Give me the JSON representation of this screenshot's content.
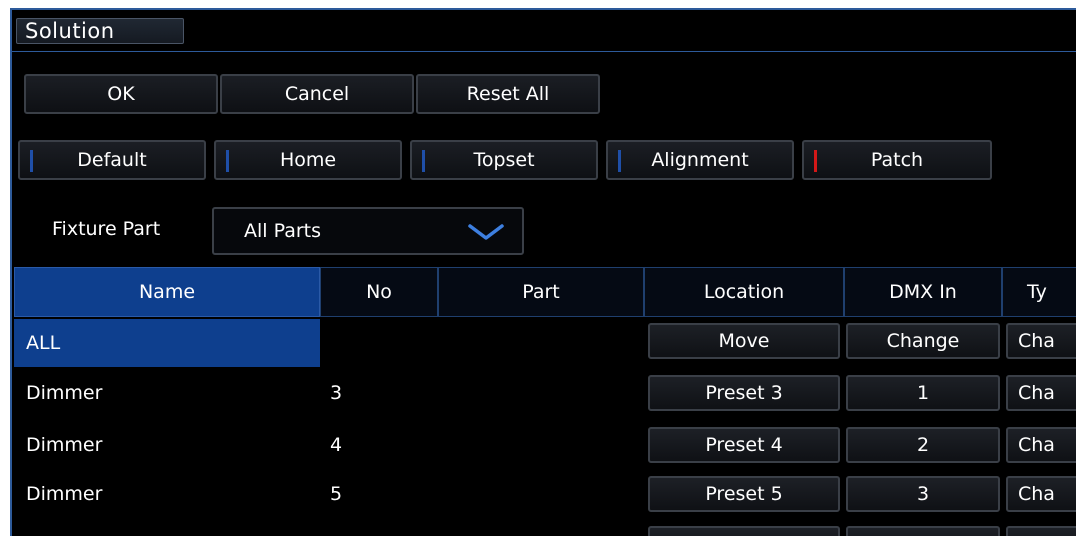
{
  "window": {
    "title": "Solution"
  },
  "buttons": {
    "ok": "OK",
    "cancel": "Cancel",
    "reset_all": "Reset All"
  },
  "modes": [
    {
      "label": "Default",
      "indicator": "#1f4fa8"
    },
    {
      "label": "Home",
      "indicator": "#1f4fa8"
    },
    {
      "label": "Topset",
      "indicator": "#1f4fa8"
    },
    {
      "label": "Alignment",
      "indicator": "#1f4fa8"
    },
    {
      "label": "Patch",
      "indicator": "#d31818"
    }
  ],
  "fixture_part": {
    "label": "Fixture Part",
    "value": "All Parts",
    "icon": "chevron-down-icon"
  },
  "table": {
    "columns": [
      "Name",
      "No",
      "Part",
      "Location",
      "DMX In",
      "Ty"
    ],
    "selected_column": "Name",
    "all_row": {
      "name": "ALL",
      "location": "Move",
      "dmx": "Change",
      "type": "Cha"
    },
    "rows": [
      {
        "name": "Dimmer",
        "no": "3",
        "location": "Preset 3",
        "dmx": "1",
        "type": "Cha"
      },
      {
        "name": "Dimmer",
        "no": "4",
        "location": "Preset 4",
        "dmx": "2",
        "type": "Cha"
      },
      {
        "name": "Dimmer",
        "no": "5",
        "location": "Preset 5",
        "dmx": "3",
        "type": "Cha"
      }
    ]
  },
  "colors": {
    "accent": "#0e3f8e",
    "border": "#2d5a9a",
    "background": "#000000"
  }
}
